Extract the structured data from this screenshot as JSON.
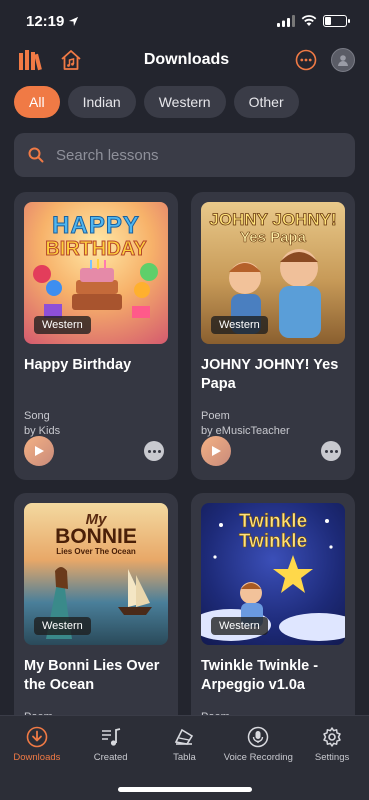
{
  "status_bar": {
    "time": "12:19"
  },
  "header": {
    "title": "Downloads"
  },
  "filters": [
    {
      "label": "All",
      "active": true
    },
    {
      "label": "Indian",
      "active": false
    },
    {
      "label": "Western",
      "active": false
    },
    {
      "label": "Other",
      "active": false
    }
  ],
  "search": {
    "placeholder": "Search lessons"
  },
  "cards": [
    {
      "art_text": "HAPPY BIRTHDAY",
      "tag": "Western",
      "title": "Happy Birthday",
      "type": "Song",
      "author": "by Kids"
    },
    {
      "art_text": "JOHNY JOHNY! Yes Papa",
      "tag": "Western",
      "title": "JOHNY JOHNY! Yes Papa",
      "type": "Poem",
      "author": "by eMusicTeacher"
    },
    {
      "art_text": "My BONNIE Lies Over The Ocean",
      "tag": "Western",
      "title": "My Bonni Lies Over the Ocean",
      "type": "Poem",
      "author": ""
    },
    {
      "art_text": "Twinkle Twinkle",
      "tag": "Western",
      "title": "Twinkle Twinkle - Arpeggio v1.0a",
      "type": "Poem",
      "author": ""
    }
  ],
  "tabs": [
    {
      "label": "Downloads",
      "icon": "download-icon",
      "active": true
    },
    {
      "label": "Created",
      "icon": "music-note-icon",
      "active": false
    },
    {
      "label": "Tabla",
      "icon": "tabla-icon",
      "active": false
    },
    {
      "label": "Voice Recording",
      "icon": "microphone-icon",
      "active": false
    },
    {
      "label": "Settings",
      "icon": "gear-icon",
      "active": false
    }
  ],
  "colors": {
    "accent": "#f07a45",
    "background": "#23252e",
    "card": "#353742"
  }
}
